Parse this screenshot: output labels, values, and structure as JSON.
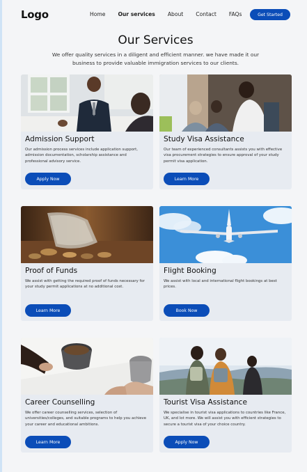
{
  "nav": {
    "logo": "Logo",
    "links": [
      "Home",
      "Our services",
      "About",
      "Contact",
      "FAQs"
    ],
    "active": "Our services",
    "cta_label": "Get Started"
  },
  "header": {
    "title": "Our Services",
    "intro": "We offer quality services in a diligent and efficient manner. we have made it our business to provide valuable immigration services to our clients."
  },
  "cards": [
    {
      "title": "Admission Support",
      "description": "Our admission process services include application support, admission documentation, scholarship assistance and professional advisory service.",
      "button": "Apply Now",
      "image": "office-meeting-photo"
    },
    {
      "title": "Study Visa Assistance",
      "description": "Our team of experienced consultants assists you with effective visa procurement strategies to ensure approval of your study permit visa application.",
      "button": "Learn More",
      "image": "students-photo"
    },
    {
      "title": "Proof of Funds",
      "description": "We assist with getting the required proof of funds necessary for your study permit applications at no additional cost.",
      "button": "Learn More",
      "image": "coins-jar-photo"
    },
    {
      "title": "Flight Booking",
      "description": "We assist with local and international flight bookings at best prices.",
      "button": "Book Now",
      "image": "airplane-sky-photo"
    },
    {
      "title": "Career Counselling",
      "description": "We offer career counselling services, selection of universities/colleges, and suitable programs to help you achieve your career and educational ambitions.",
      "button": "Learn More",
      "image": "coffee-cups-photo"
    },
    {
      "title": "Tourist Visa Assistance",
      "description": "We specialise in tourist visa applications to countries like France, UK, and lot more. We will assist you with efficient strategies to secure a tourist visa of your choice country.",
      "button": "Apply Now",
      "image": "hikers-photo"
    }
  ],
  "colors": {
    "accent": "#0b4db8",
    "card_bg": "#e7ebf1",
    "page_bg": "#f4f5f7"
  }
}
